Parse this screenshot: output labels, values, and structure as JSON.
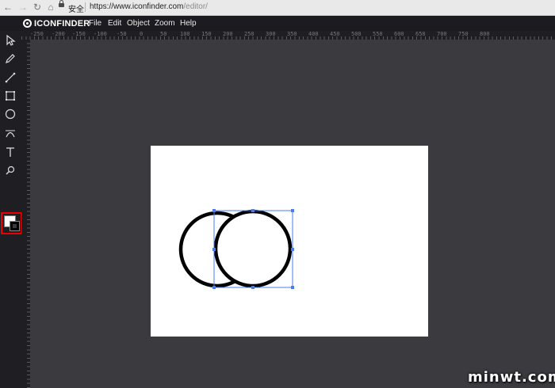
{
  "browser": {
    "secure_label": "安全",
    "url_main": "https://www.iconfinder.com",
    "url_path": "/editor/"
  },
  "app": {
    "logo_text": "ICONFINDER",
    "menu": [
      "File",
      "Edit",
      "Object",
      "Zoom",
      "Help"
    ]
  },
  "tools": [
    "select-arrow-icon",
    "pen-icon",
    "line-icon",
    "rectangle-icon",
    "ellipse-icon",
    "curve-icon",
    "text-icon",
    "zoom-icon"
  ],
  "colors": {
    "fill": "#ffffff",
    "stroke": "#000000",
    "highlight": "#e00000",
    "selection": "#4a7cf0"
  },
  "ruler_labels": [
    "-250",
    "-200",
    "-150",
    "-100",
    "-50",
    "0",
    "50",
    "100",
    "150",
    "200",
    "250",
    "300",
    "350",
    "400",
    "450",
    "500",
    "550",
    "600",
    "650",
    "700",
    "750",
    "800"
  ],
  "watermark": "minwt.com"
}
